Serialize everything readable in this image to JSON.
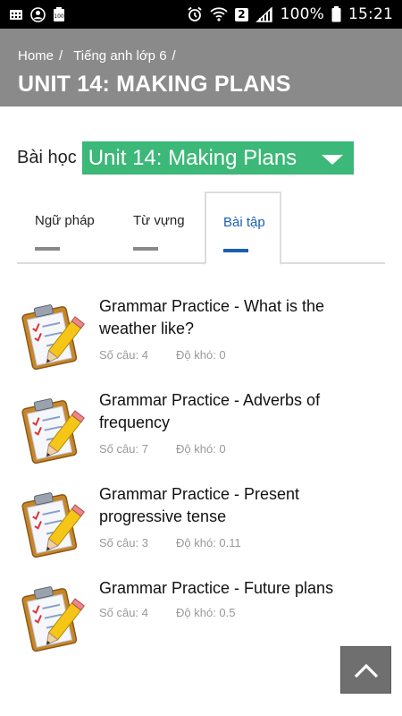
{
  "status_bar": {
    "battery_percent": "100%",
    "time": "15:21",
    "sim_badge": "2",
    "icons": [
      "app-grid-icon",
      "account-circle-icon",
      "battery-saver-icon",
      "alarm-icon",
      "wifi-icon",
      "sim2-icon",
      "signal-icon",
      "battery-icon"
    ]
  },
  "breadcrumb": {
    "home": "Home",
    "separator": "/",
    "section": "Tiếng anh lớp 6"
  },
  "page_title": "UNIT 14: MAKING PLANS",
  "lesson": {
    "label": "Bài học",
    "selected": "Unit 14: Making Plans"
  },
  "tabs": {
    "grammar": "Ngữ pháp",
    "vocabulary": "Từ vựng",
    "exercises": "Bài tập",
    "active": "exercises"
  },
  "exercises": [
    {
      "title": "Grammar Practice - What is the weather like?",
      "questions_label": "Số câu: 4",
      "difficulty_label": "Độ khó: 0"
    },
    {
      "title": "Grammar Practice - Adverbs of frequency",
      "questions_label": "Số câu: 7",
      "difficulty_label": "Độ khó: 0"
    },
    {
      "title": "Grammar Practice - Present progressive tense",
      "questions_label": "Số câu: 3",
      "difficulty_label": "Độ khó: 0.11"
    },
    {
      "title": "Grammar Practice - Future plans",
      "questions_label": "Số câu: 4",
      "difficulty_label": "Độ khó: 0.5"
    }
  ],
  "colors": {
    "header_bg": "#8a8a8a",
    "select_bg": "#3cb878",
    "active_tab": "#1a5fb4",
    "scroll_button_bg": "#6f6f6f"
  },
  "scroll_top_icon": "chevron-up-icon"
}
